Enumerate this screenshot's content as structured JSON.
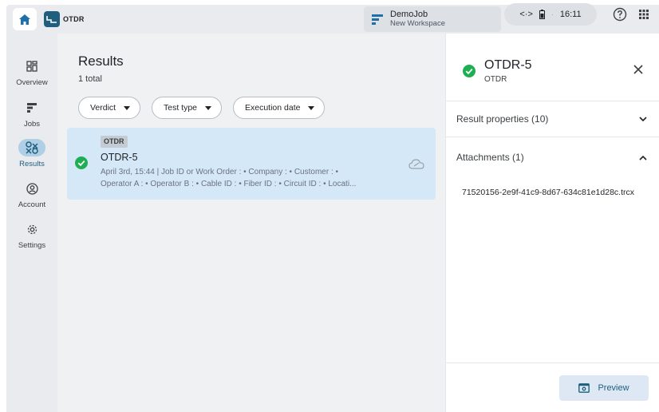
{
  "topbar": {
    "app_name": "OTDR",
    "workspace": {
      "name": "DemoJob",
      "subtitle": "New Workspace"
    },
    "status": {
      "connection_icon": "<·>",
      "time": "16:11"
    },
    "icons": [
      "home-icon",
      "otdr-app-icon",
      "workspace-icon",
      "connection-icon",
      "battery-icon",
      "help-icon",
      "apps-grid-icon"
    ]
  },
  "rail": {
    "items": [
      {
        "label": "Overview",
        "icon": "overview-icon",
        "active": false
      },
      {
        "label": "Jobs",
        "icon": "jobs-icon",
        "active": false
      },
      {
        "label": "Results",
        "icon": "results-icon",
        "active": true
      },
      {
        "label": "Account",
        "icon": "account-icon",
        "active": false
      },
      {
        "label": "Settings",
        "icon": "settings-icon",
        "active": false
      }
    ]
  },
  "main": {
    "title": "Results",
    "count": "1 total",
    "filters": [
      {
        "label": "Verdict"
      },
      {
        "label": "Test type"
      },
      {
        "label": "Execution date"
      }
    ],
    "results": [
      {
        "tag": "OTDR",
        "name": "OTDR-5",
        "meta_line1": "April 3rd, 15:44  | Job ID or Work Order : • Company : • Customer : •",
        "meta_line2": "Operator A : • Operator B : • Cable ID : • Fiber ID : • Circuit ID : • Locati...",
        "status": "pass"
      }
    ]
  },
  "panel": {
    "title": "OTDR-5",
    "subtitle": "OTDR",
    "sections": [
      {
        "label": "Result properties (10)",
        "expanded": false
      },
      {
        "label": "Attachments (1)",
        "expanded": true
      }
    ],
    "attachment": "71520156-2e9f-41c9-8d67-634c81e1d28c.trcx",
    "preview_label": "Preview"
  },
  "colors": {
    "accent": "#1f5f7d",
    "pass_green": "#1fae52",
    "selected_row": "#d5e8f8",
    "rail_bg": "#e9ebee",
    "main_bg": "#eff1f3"
  }
}
